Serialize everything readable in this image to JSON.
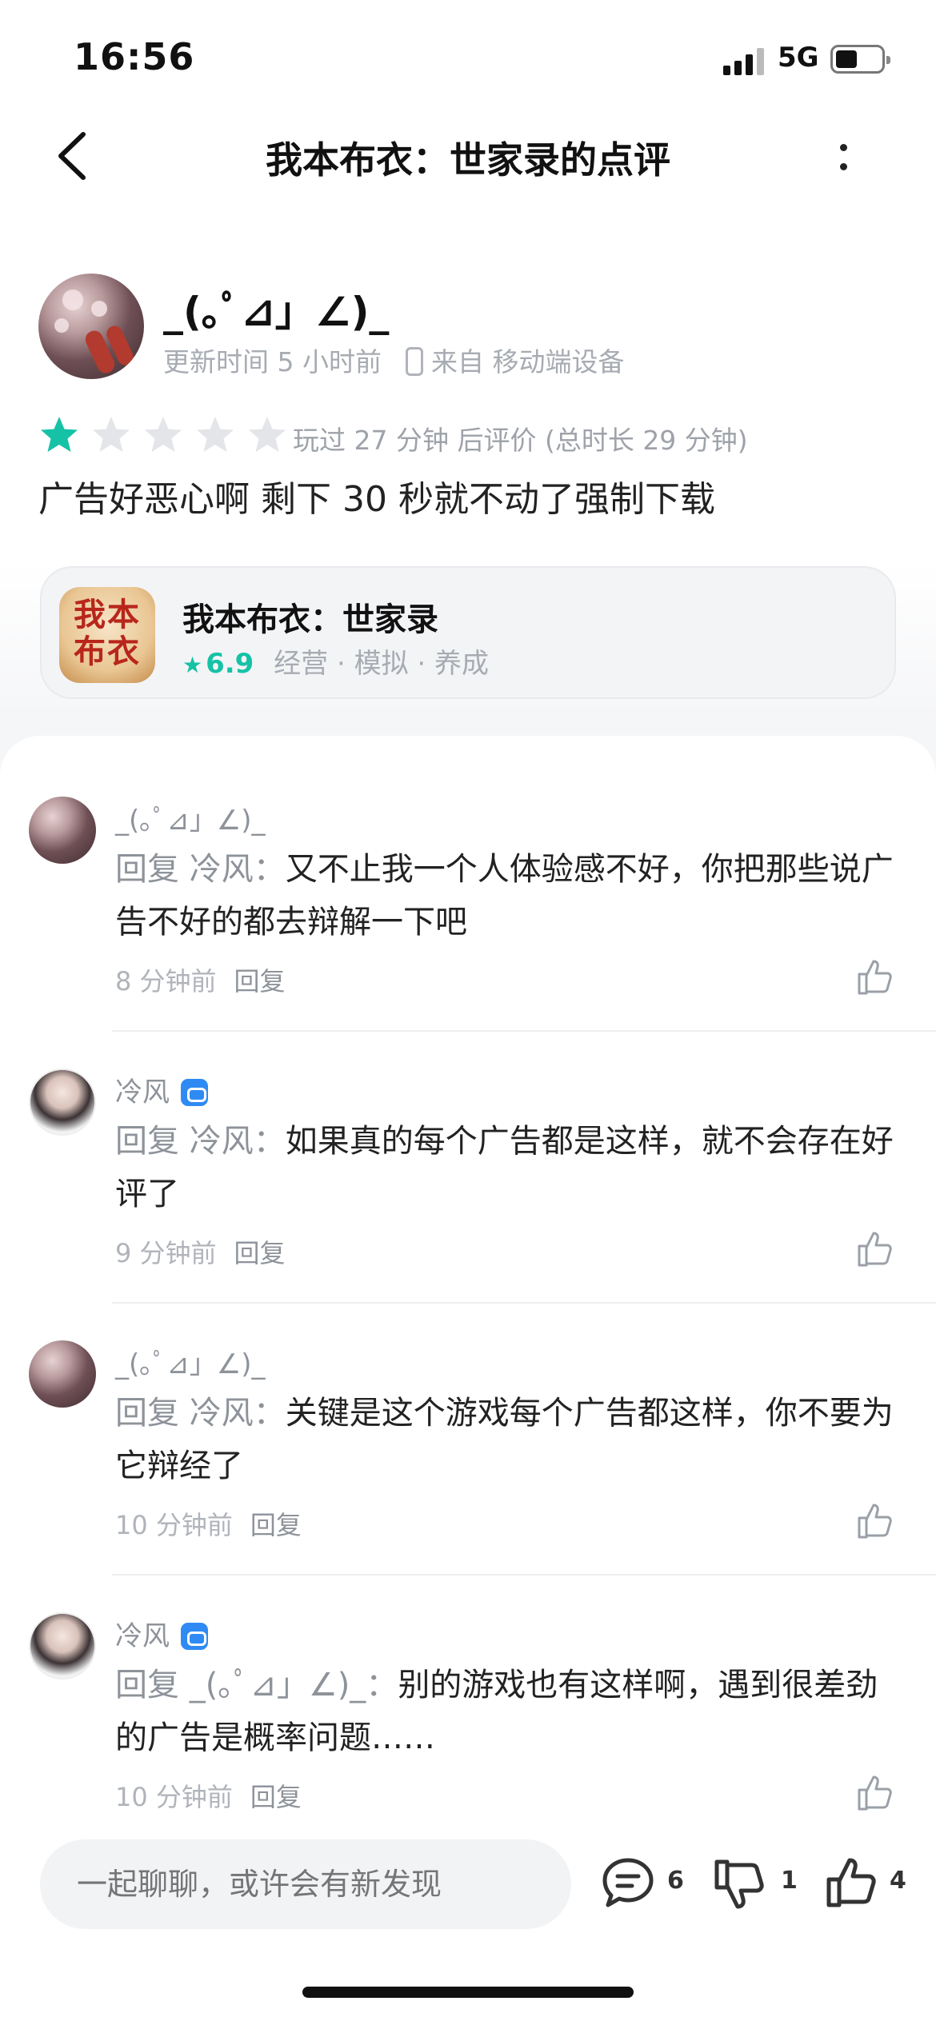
{
  "status_bar": {
    "time": "16:56",
    "network": "5G"
  },
  "nav": {
    "title": "我本布衣：世家录的点评"
  },
  "review": {
    "username": "_(｡ﾟ⊿」∠)_",
    "updated": "更新时间 5 小时前",
    "device": "来自 移动端设备",
    "rating": 1,
    "max_rating": 5,
    "played": "玩过 27 分钟 后评价 (总时长 29 分钟)",
    "text": "广告好恶心啊 剩下 30 秒就不动了强制下载"
  },
  "game": {
    "icon_text": "我本\n布衣",
    "name": "我本布衣：世家录",
    "score": "6.9",
    "tags": "经营 · 模拟 · 养成"
  },
  "replies": [
    {
      "author": "_(｡ﾟ⊿」∠)_",
      "verified": false,
      "prefix": "回复 冷风：",
      "text": "又不止我一个人体验感不好，你把那些说广告不好的都去辩解一下吧",
      "time": "8 分钟前",
      "reply_label": "回复"
    },
    {
      "author": "冷风",
      "verified": true,
      "prefix": "回复 冷风：",
      "text": "如果真的每个广告都是这样，就不会存在好评了",
      "time": "9 分钟前",
      "reply_label": "回复"
    },
    {
      "author": "_(｡ﾟ⊿」∠)_",
      "verified": false,
      "prefix": "回复 冷风：",
      "text": "关键是这个游戏每个广告都这样，你不要为它辩经了",
      "time": "10 分钟前",
      "reply_label": "回复"
    },
    {
      "author": "冷风",
      "verified": true,
      "prefix": "回复 _(｡ﾟ⊿」∠)_：",
      "text": "别的游戏也有这样啊，遇到很差劲的广告是概率问题……",
      "time": "10 分钟前",
      "reply_label": "回复"
    }
  ],
  "bottom_bar": {
    "placeholder": "一起聊聊，或许会有新发现",
    "comments": "6",
    "dislikes": "1",
    "likes": "4"
  },
  "colors": {
    "accent": "#16c2a6",
    "badge": "#2f8bf3",
    "muted": "#a7abb2"
  }
}
